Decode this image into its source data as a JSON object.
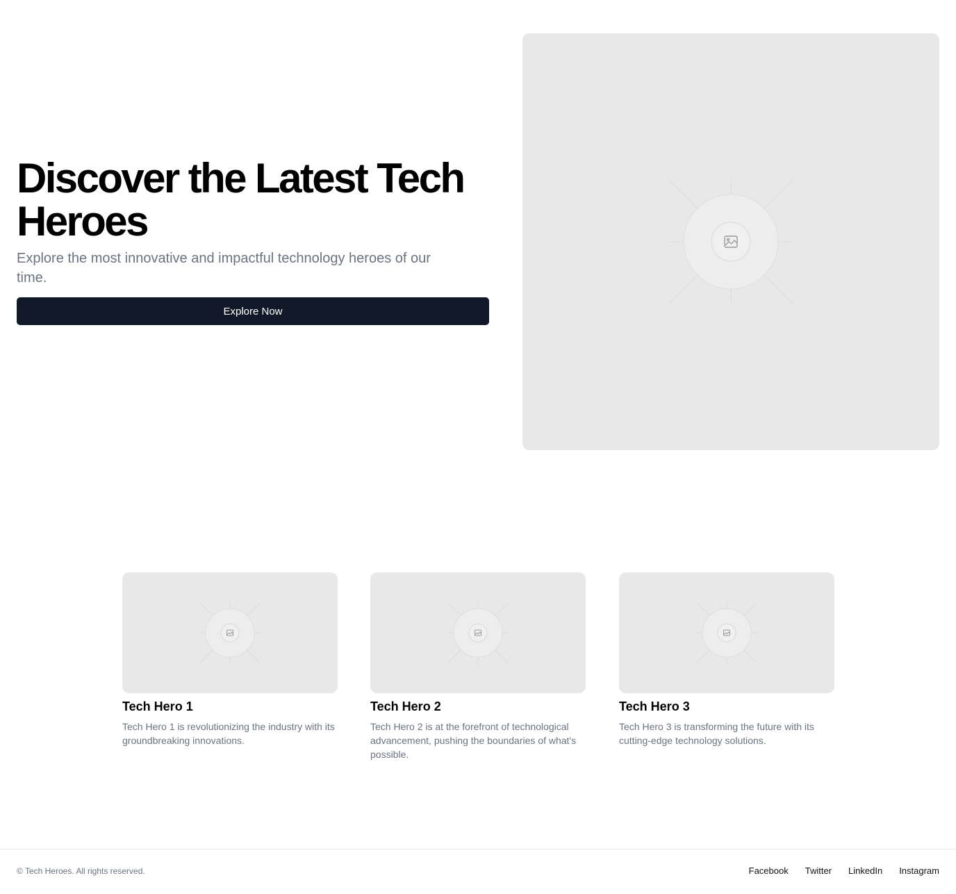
{
  "hero": {
    "title": "Discover the Latest Tech Heroes",
    "subtitle": "Explore the most innovative and impactful technology heroes of our time.",
    "button_label": "Explore Now"
  },
  "cards": [
    {
      "title": "Tech Hero 1",
      "description": "Tech Hero 1 is revolutionizing the industry with its groundbreaking innovations."
    },
    {
      "title": "Tech Hero 2",
      "description": "Tech Hero 2 is at the forefront of technological advancement, pushing the boundaries of what's possible."
    },
    {
      "title": "Tech Hero 3",
      "description": "Tech Hero 3 is transforming the future with its cutting-edge technology solutions."
    }
  ],
  "footer": {
    "copyright": "© Tech Heroes. All rights reserved.",
    "links": [
      "Facebook",
      "Twitter",
      "LinkedIn",
      "Instagram"
    ]
  },
  "colors": {
    "button_bg": "#111827",
    "muted_text": "#6b7280",
    "placeholder_bg": "#e8e8e8"
  },
  "icons": {
    "hero_image": "image-placeholder-icon",
    "card_image": "image-placeholder-icon"
  }
}
